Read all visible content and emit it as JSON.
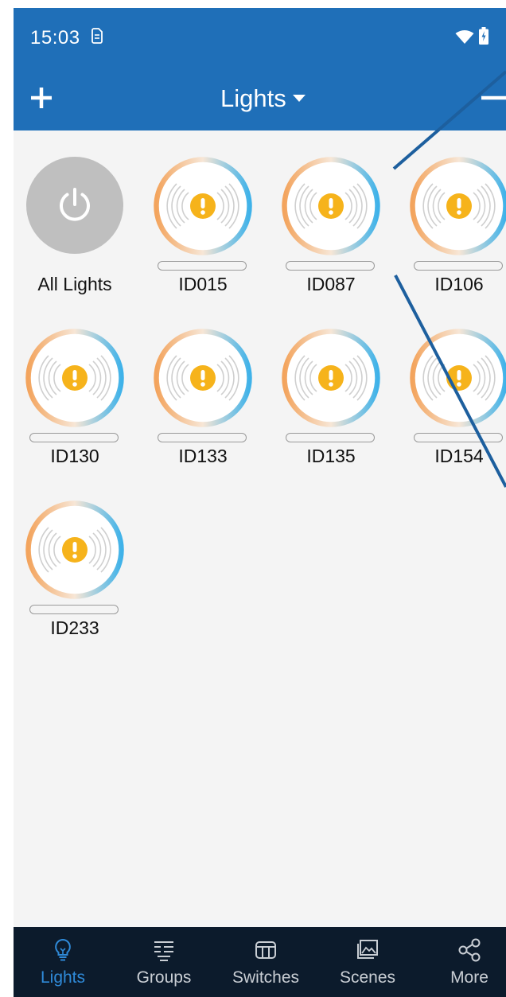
{
  "status_bar": {
    "time": "15:03",
    "sim_icon": "sim-card-icon",
    "wifi_icon": "wifi-icon",
    "battery_icon": "battery-charging-icon"
  },
  "app_bar": {
    "title": "Lights",
    "add_icon": "plus-icon",
    "dropdown_icon": "caret-down-icon",
    "remove_icon": "minus-icon"
  },
  "tiles": [
    {
      "label": "All Lights",
      "type": "all",
      "icon": "power-icon"
    },
    {
      "label": "ID015",
      "type": "light",
      "icon": "warning-icon"
    },
    {
      "label": "ID087",
      "type": "light",
      "icon": "warning-icon"
    },
    {
      "label": "ID106",
      "type": "light",
      "icon": "warning-icon"
    },
    {
      "label": "ID130",
      "type": "light",
      "icon": "warning-icon"
    },
    {
      "label": "ID133",
      "type": "light",
      "icon": "warning-icon"
    },
    {
      "label": "ID135",
      "type": "light",
      "icon": "warning-icon"
    },
    {
      "label": "ID154",
      "type": "light",
      "icon": "warning-icon"
    },
    {
      "label": "ID233",
      "type": "light",
      "icon": "warning-icon"
    }
  ],
  "bottom_nav": {
    "items": [
      {
        "label": "Lights",
        "icon": "lightbulb-icon",
        "active": true
      },
      {
        "label": "Groups",
        "icon": "groups-icon",
        "active": false
      },
      {
        "label": "Switches",
        "icon": "switch-icon",
        "active": false
      },
      {
        "label": "Scenes",
        "icon": "scenes-icon",
        "active": false
      },
      {
        "label": "More",
        "icon": "share-icon",
        "active": false
      }
    ]
  },
  "colors": {
    "primary": "#1f6fb8",
    "nav_background": "#0c1b2c",
    "nav_active": "#2f8ad8",
    "warning": "#f6b31b",
    "ring_warm": "#f0a868",
    "ring_cool": "#4ab3e8",
    "background": "#f4f4f4"
  }
}
